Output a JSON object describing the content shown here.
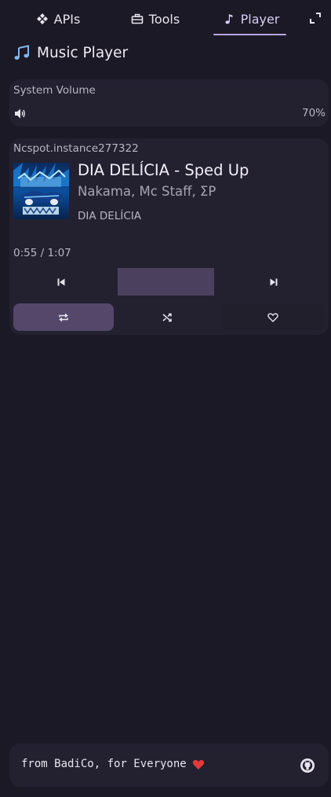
{
  "tabs": [
    {
      "label": "APIs",
      "icon": "diamond-arrows-icon"
    },
    {
      "label": "Tools",
      "icon": "toolbox-icon"
    },
    {
      "label": "Player",
      "icon": "music-note-icon",
      "active": true
    }
  ],
  "header": {
    "title": "Music Player",
    "icon": "music-notes-icon"
  },
  "volume": {
    "label": "System Volume",
    "value": "70%",
    "level": 0.7
  },
  "player": {
    "instance": "Ncspot.instance277322",
    "track_title": "DIA DELÍCIA - Sped Up",
    "artists": "Nakama, Mc Staff, ΣP",
    "album": "DIA DELÍCIA",
    "time": "0:55 / 1:07",
    "repeat_active": true
  },
  "footer": {
    "text": "from BadiCo, for Everyone"
  },
  "colors": {
    "background": "#1b1925",
    "card": "#232130",
    "accent": "#b9a7e6",
    "button_active": "#54476a",
    "heart": "#e5383b"
  }
}
